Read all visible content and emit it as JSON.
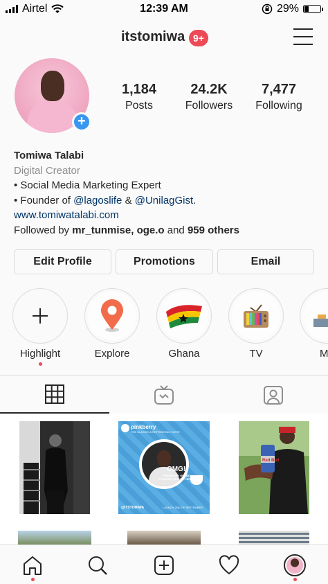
{
  "status_bar": {
    "carrier": "Airtel",
    "time": "12:39 AM",
    "battery_percent": "29%",
    "battery_level": 0.29
  },
  "header": {
    "username": "itstomiwa",
    "notifications_badge": "9+"
  },
  "profile": {
    "stats": [
      {
        "value": "1,184",
        "label": "Posts"
      },
      {
        "value": "24.2K",
        "label": "Followers"
      },
      {
        "value": "7,477",
        "label": "Following"
      }
    ],
    "name": "Tomiwa Talabi",
    "category": "Digital Creator",
    "bio_line1": "• Social Media Marketing Expert",
    "bio_line2_prefix": "• Founder of ",
    "mention1": "@lagoslife",
    "bio_line2_mid": " & ",
    "mention2": "@UnilagGist",
    "bio_line2_suffix": ".",
    "website": "www.tomiwatalabi.com",
    "followed_by_prefix": "Followed by ",
    "followed_by_users": "mr_tunmise, oge.o",
    "followed_by_mid": " and ",
    "followed_by_others": "959 others"
  },
  "buttons": {
    "edit_profile": "Edit Profile",
    "promotions": "Promotions",
    "email": "Email"
  },
  "highlights": [
    {
      "label": "Highlight"
    },
    {
      "label": "Explore"
    },
    {
      "label": "Ghana"
    },
    {
      "label": "TV"
    },
    {
      "label": "M"
    }
  ],
  "posts": {
    "pinkberry_brand": "pinkberry",
    "pinkberry_tagline": "THE CLASSIC & REFRESHING TASTE",
    "pinkberry_headline": "OMG!",
    "pinkberry_sub": "PINKBERRY GREEK YOGHURT ALMOST HERE!",
    "pinkberry_handle": "@ITSTOMIWA",
    "pinkberry_date": "LAUNCH 2ND OF SEPTEMBER",
    "redbull_text": "Red Bull"
  },
  "colors": {
    "accent_blue": "#3897f0",
    "badge_red": "#ed4956",
    "link_blue": "#003569"
  }
}
